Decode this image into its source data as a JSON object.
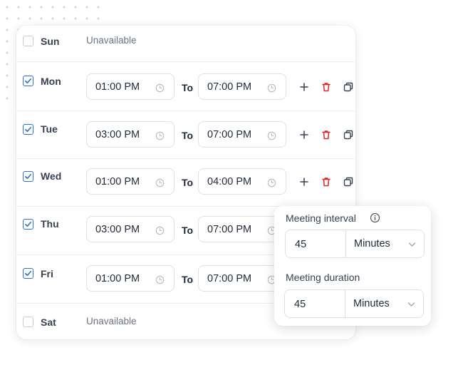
{
  "schedule": {
    "to_label": "To",
    "rows": [
      {
        "day": "Sun",
        "checked": false,
        "unavailable": "Unavailable"
      },
      {
        "day": "Mon",
        "checked": true,
        "from": "01:00 PM",
        "to": "07:00 PM"
      },
      {
        "day": "Tue",
        "checked": true,
        "from": "03:00 PM",
        "to": "07:00 PM"
      },
      {
        "day": "Wed",
        "checked": true,
        "from": "01:00 PM",
        "to": "04:00 PM"
      },
      {
        "day": "Thu",
        "checked": true,
        "from": "03:00 PM",
        "to": "07:00 PM"
      },
      {
        "day": "Fri",
        "checked": true,
        "from": "01:00 PM",
        "to": "07:00 PM"
      },
      {
        "day": "Sat",
        "checked": false,
        "unavailable": "Unavailable"
      }
    ]
  },
  "settings": {
    "interval_label": "Meeting interval",
    "interval_value": "45",
    "interval_unit": "Minutes",
    "duration_label": "Meeting duration",
    "duration_value": "45",
    "duration_unit": "Minutes"
  },
  "colors": {
    "accent": "#2f6fd6",
    "delete": "#dc2626",
    "muted_text": "#6b7280"
  },
  "icons": {
    "clock": "clock-icon",
    "add": "plus-icon",
    "delete": "trash-icon",
    "copy": "copy-icon",
    "info": "info-icon",
    "dropdown": "chevron-down-icon",
    "check": "checkmark-icon"
  }
}
